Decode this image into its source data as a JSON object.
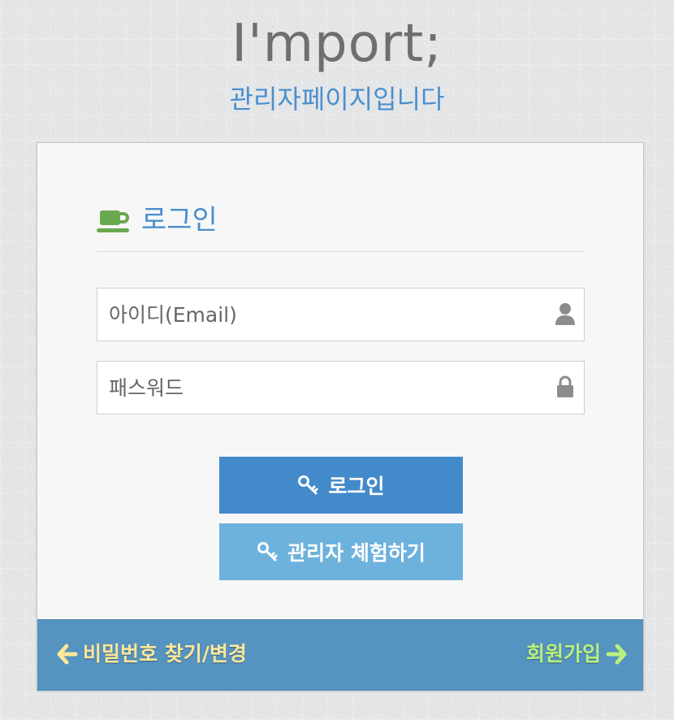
{
  "brand": {
    "title": "I'mport;",
    "subtitle": "관리자페이지입니다"
  },
  "login_panel": {
    "title": "로그인",
    "icon": "coffee-cup-icon",
    "email_field": {
      "placeholder": "아이디(Email)",
      "value": "",
      "icon": "user-icon"
    },
    "password_field": {
      "placeholder": "패스워드",
      "value": "",
      "icon": "lock-icon"
    },
    "login_button": {
      "label": "로그인",
      "icon": "key-icon"
    },
    "demo_button": {
      "label": "관리자 체험하기",
      "icon": "key-icon"
    }
  },
  "footer": {
    "find_password": {
      "label": "비밀번호 찾기/변경",
      "icon": "arrow-left-icon"
    },
    "signup": {
      "label": "회원가입",
      "icon": "arrow-right-icon"
    }
  },
  "colors": {
    "accent_blue": "#438acb",
    "secondary_blue": "#6cb2dd",
    "footer_blue": "#5593c0",
    "link_yellow": "#fce79a",
    "link_green": "#b8f07e",
    "icon_green": "#6aa84f"
  }
}
